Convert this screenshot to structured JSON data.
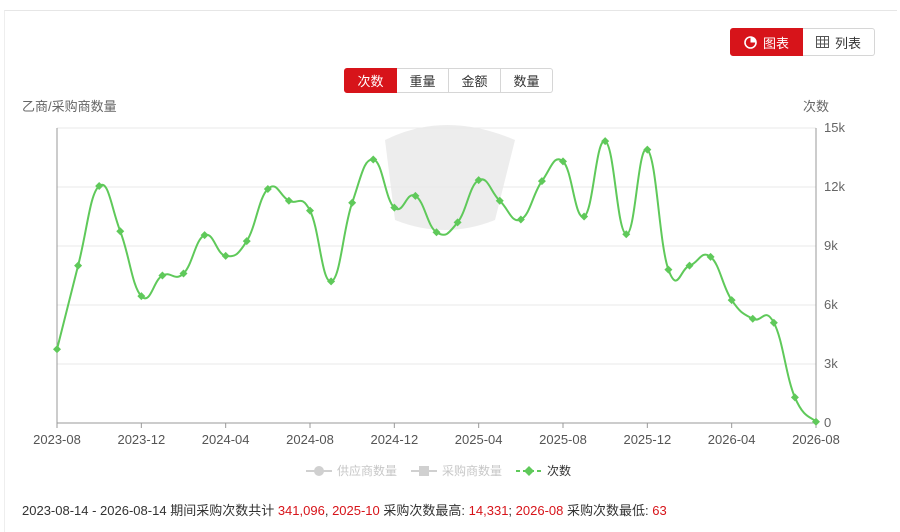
{
  "view_toggle": {
    "chart_label": "图表",
    "list_label": "列表"
  },
  "metric_tabs": [
    "次数",
    "重量",
    "金额",
    "数量"
  ],
  "chart_data": {
    "type": "line",
    "left_axis_title": "乙商/采购商数量",
    "right_axis_title": "次数",
    "x": [
      "2023-08",
      "2023-09",
      "2023-10",
      "2023-11",
      "2023-12",
      "2024-01",
      "2024-02",
      "2024-03",
      "2024-04",
      "2024-05",
      "2024-06",
      "2024-07",
      "2024-08",
      "2024-09",
      "2024-10",
      "2024-11",
      "2024-12",
      "2025-01",
      "2025-02",
      "2025-03",
      "2025-04",
      "2025-05",
      "2025-06",
      "2025-07",
      "2025-08",
      "2025-09",
      "2025-10",
      "2025-11",
      "2025-12",
      "2026-01",
      "2026-02",
      "2026-03",
      "2026-04",
      "2026-05",
      "2026-06",
      "2026-07",
      "2026-08"
    ],
    "x_tick_labels": [
      "2023-08",
      "2023-12",
      "2024-04",
      "2024-08",
      "2024-12",
      "2025-04",
      "2025-08",
      "2025-12",
      "2026-04",
      "2026-08"
    ],
    "y_ticks": [
      "0",
      "3k",
      "6k",
      "9k",
      "12k",
      "15k"
    ],
    "ylim": [
      0,
      15000
    ],
    "series": [
      {
        "name": "次数",
        "color": "#5fc95a",
        "values": [
          3750,
          8000,
          12050,
          9750,
          6450,
          7500,
          7600,
          9550,
          8500,
          9250,
          11900,
          11300,
          10800,
          7200,
          11200,
          13400,
          10950,
          11550,
          9700,
          10200,
          12350,
          11300,
          10350,
          12300,
          13300,
          10500,
          14331,
          9600,
          13900,
          7800,
          8000,
          8450,
          6250,
          5300,
          5100,
          1300,
          63
        ]
      }
    ],
    "legend": [
      {
        "name": "供应商数量",
        "active": false
      },
      {
        "name": "采购商数量",
        "active": false
      },
      {
        "name": "次数",
        "active": true
      }
    ],
    "legend_placement": "bottom-center",
    "grid": true
  },
  "summary": {
    "range": "2023-08-14 - 2026-08-14",
    "total_text": "期间采购次数共计",
    "total_value": "341,096",
    "max_period": "2025-10",
    "max_text": "采购次数最高:",
    "max_value": "14,331",
    "min_period": "2026-08",
    "min_text": "采购次数最低:",
    "min_value": "63"
  }
}
